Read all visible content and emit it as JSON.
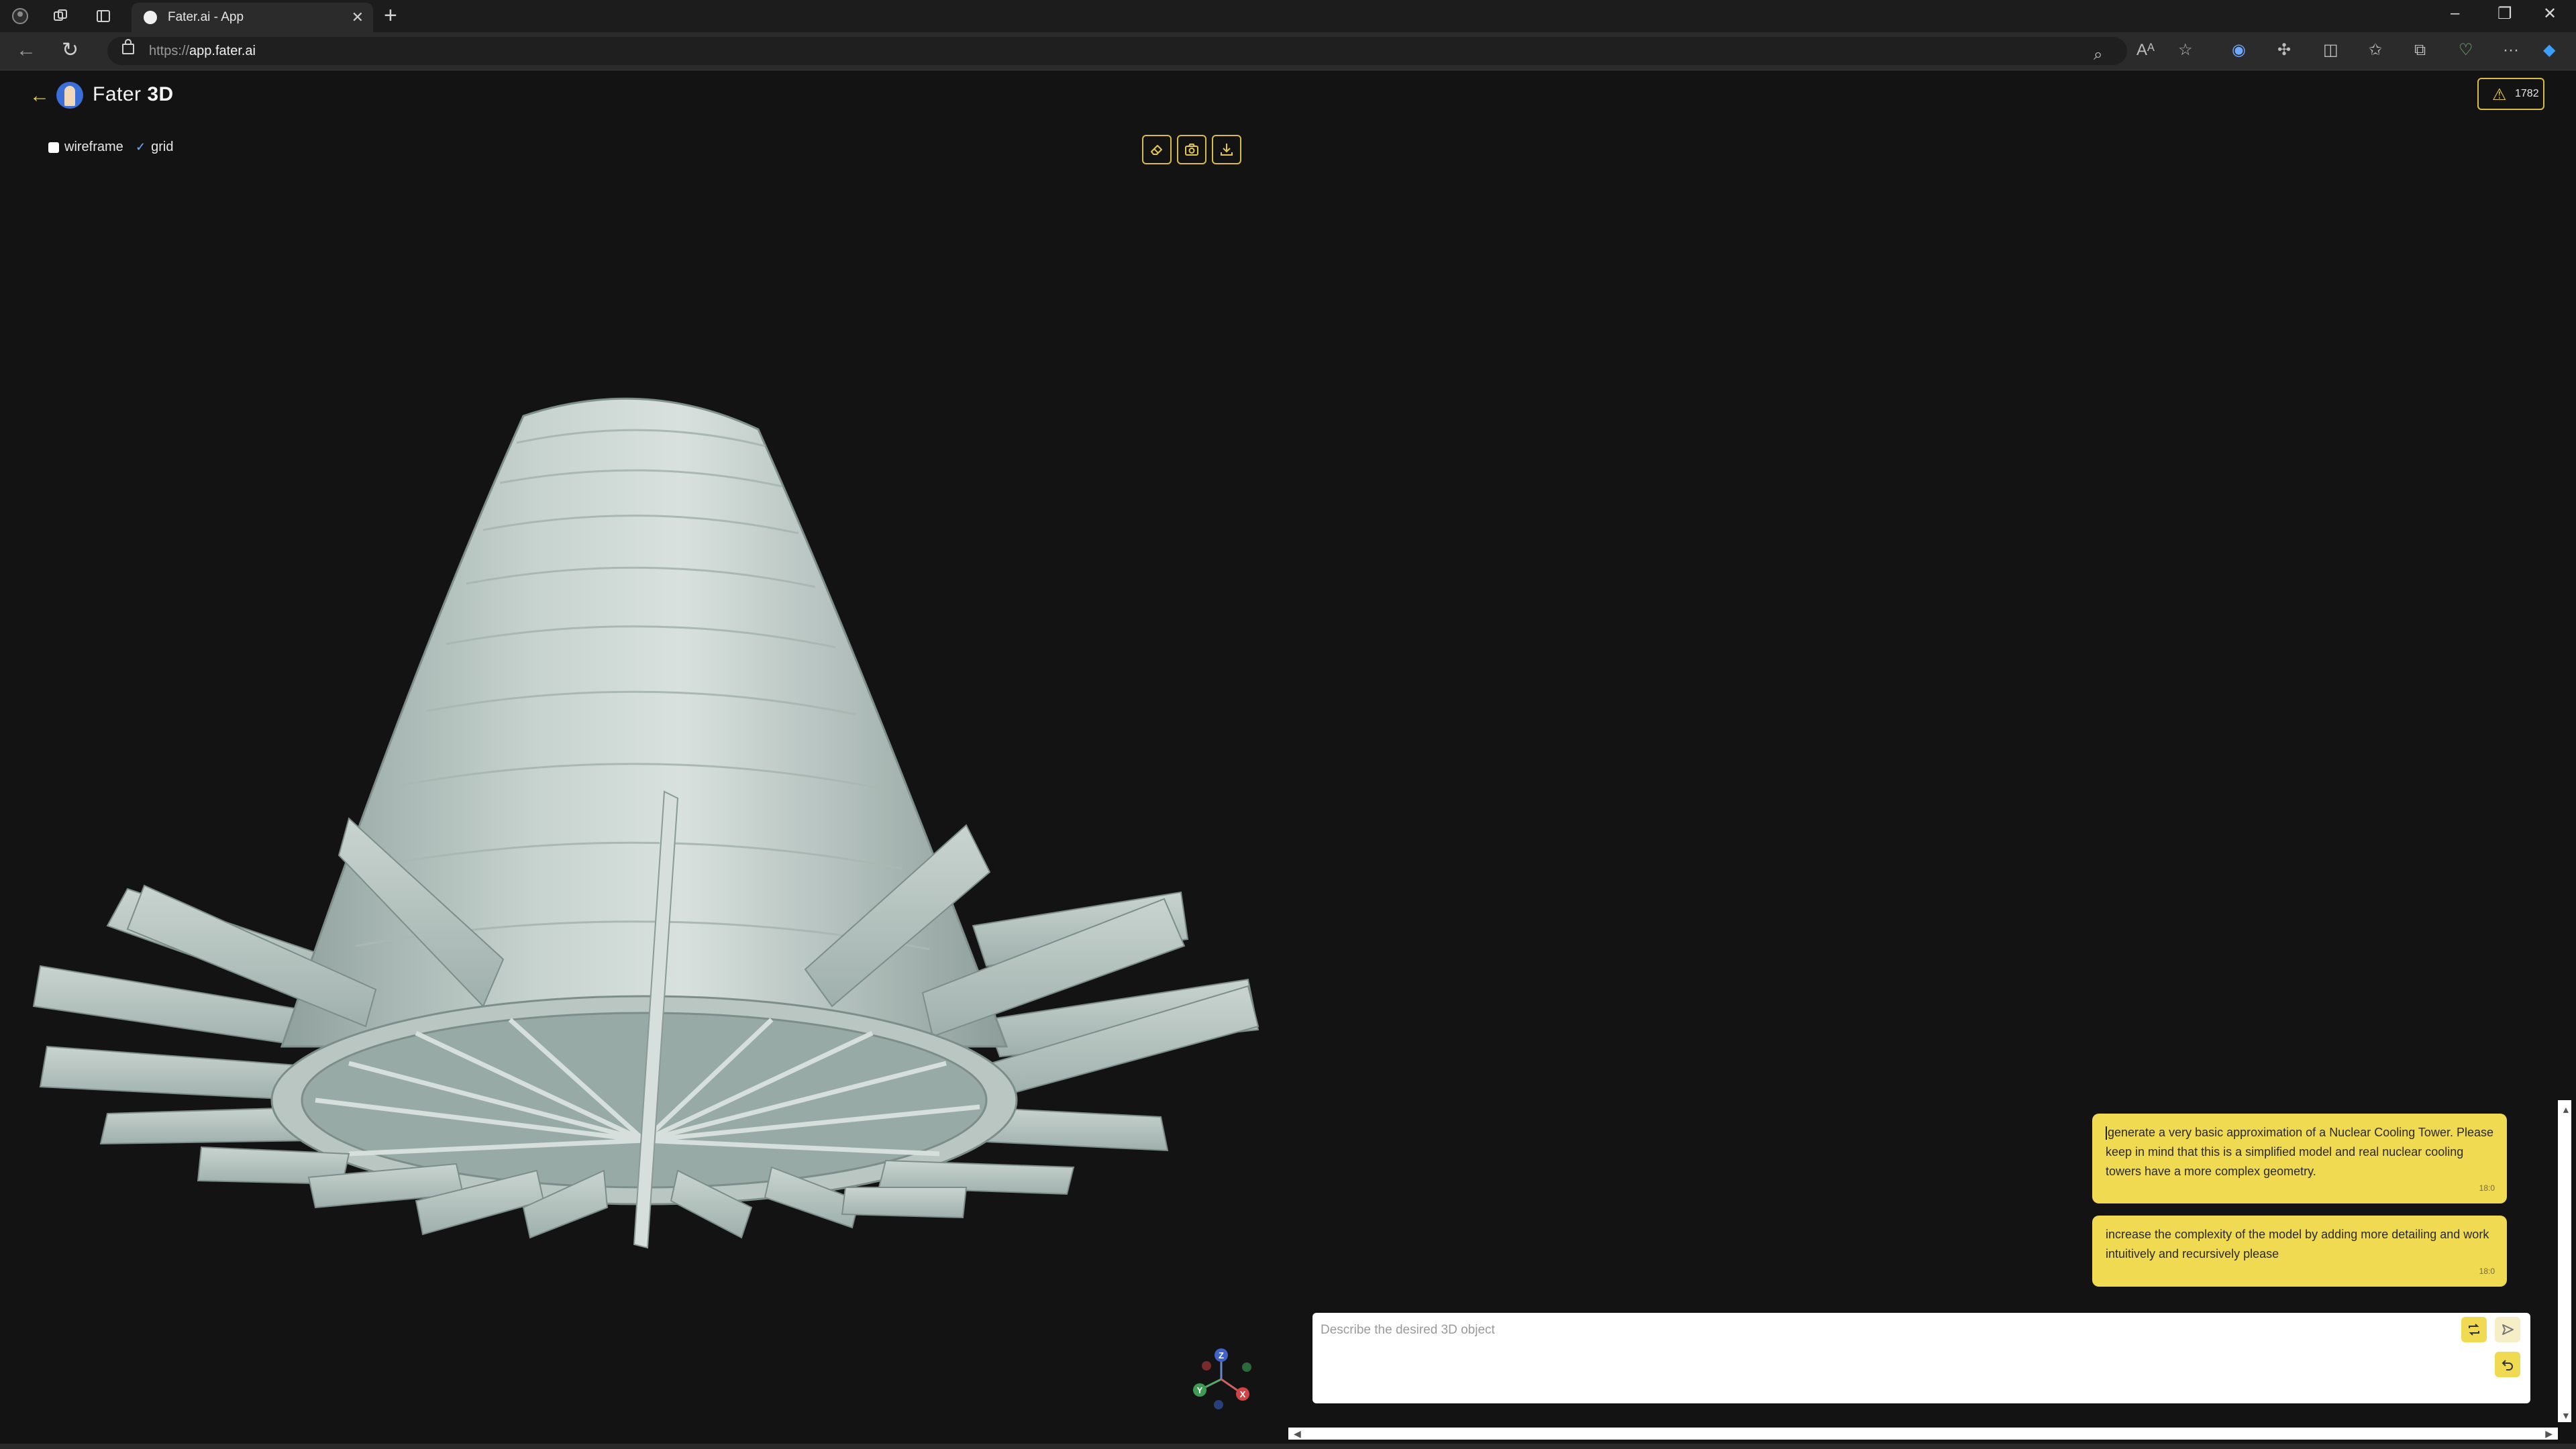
{
  "browser": {
    "tab_title": "Fater.ai - App",
    "url_protocol": "https://",
    "url_host": "app.fater.ai"
  },
  "app": {
    "title_light": "Fater ",
    "title_bold": "3D",
    "credits": "1782",
    "accent_color": "#e3c84f",
    "options": {
      "wireframe_label": "wireframe",
      "wireframe_checked": false,
      "grid_label": "grid",
      "grid_checked": true
    },
    "toolbar_icons": [
      "eraser-icon",
      "camera-icon",
      "download-icon"
    ],
    "axis_labels": {
      "z": "Z",
      "y": "Y",
      "x": "X"
    }
  },
  "chat": {
    "messages": [
      {
        "text": "generate a very basic approximation of a Nuclear Cooling Tower. Please keep in mind that this is a simplified model and real nuclear cooling towers have a more complex geometry.",
        "time": "18:0"
      },
      {
        "text": "increase the complexity of the model by adding more detailing and work intuitively and recursively please",
        "time": "18:0"
      }
    ],
    "input_placeholder": "Describe the desired 3D object"
  }
}
